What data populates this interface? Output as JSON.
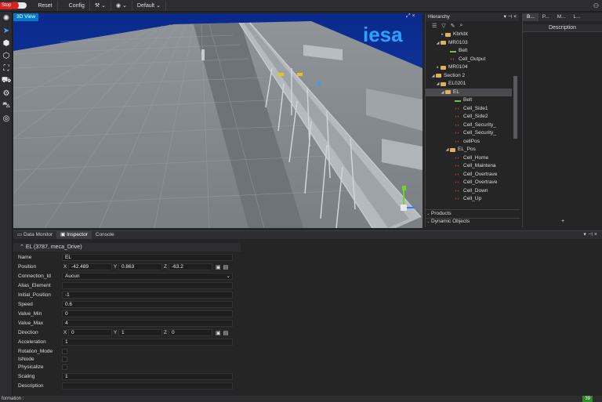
{
  "toolbar": {
    "stop_label": "Stop",
    "reset_label": "Reset",
    "config_label": "Config",
    "view_preset": "Default"
  },
  "viewport": {
    "tab_label": "3D View",
    "logo_text": "iesa"
  },
  "hierarchy": {
    "title": "Hierarchy",
    "rows": [
      {
        "label": "Kbrkbt",
        "type": "folder",
        "indent": 3,
        "arrow": "▸"
      },
      {
        "label": "MR0103",
        "type": "folder",
        "indent": 2,
        "arrow": "◢"
      },
      {
        "label": "Belt",
        "type": "belt",
        "indent": 4,
        "arrow": ""
      },
      {
        "label": "Cell_Output",
        "type": "cell",
        "indent": 4,
        "arrow": ""
      },
      {
        "label": "MR0104",
        "type": "folder",
        "indent": 2,
        "arrow": "▸"
      },
      {
        "label": "Section 2",
        "type": "folder",
        "indent": 1,
        "arrow": "◢"
      },
      {
        "label": "EL0201",
        "type": "folder",
        "indent": 2,
        "arrow": "◢"
      },
      {
        "label": "EL",
        "type": "folder",
        "indent": 3,
        "arrow": "◢",
        "selected": true
      },
      {
        "label": "Belt",
        "type": "belt",
        "indent": 5,
        "arrow": ""
      },
      {
        "label": "Cell_Side1",
        "type": "cell",
        "indent": 5,
        "arrow": ""
      },
      {
        "label": "Cell_Side2",
        "type": "cell",
        "indent": 5,
        "arrow": ""
      },
      {
        "label": "Cell_Security_",
        "type": "cell",
        "indent": 5,
        "arrow": ""
      },
      {
        "label": "Cell_Security_",
        "type": "cell",
        "indent": 5,
        "arrow": ""
      },
      {
        "label": "cellPos",
        "type": "cell",
        "indent": 5,
        "arrow": ""
      },
      {
        "label": "EL_Pos",
        "type": "folder",
        "indent": 4,
        "arrow": "◢"
      },
      {
        "label": "Cell_Home",
        "type": "cell",
        "indent": 5,
        "arrow": ""
      },
      {
        "label": "Cell_Maintena",
        "type": "cell",
        "indent": 5,
        "arrow": ""
      },
      {
        "label": "Cell_Overtrave",
        "type": "cell",
        "indent": 5,
        "arrow": ""
      },
      {
        "label": "Cell_Overtrave",
        "type": "cell",
        "indent": 5,
        "arrow": ""
      },
      {
        "label": "Cell_Down",
        "type": "cell",
        "indent": 5,
        "arrow": ""
      },
      {
        "label": "Cell_Up",
        "type": "cell",
        "indent": 5,
        "arrow": ""
      }
    ],
    "sections": [
      "Products",
      "Dynamic Objects"
    ]
  },
  "right_panel": {
    "tabs": [
      "B...",
      "P...",
      "M...",
      "L..."
    ],
    "description_header": "Description",
    "add_label": "+"
  },
  "inspector": {
    "tabs": [
      "Data Monitor",
      "Inspector",
      "Console"
    ],
    "active_tab": "Inspector",
    "object_header": "EL (3787, meca_Drive)",
    "name": "EL",
    "position": {
      "x": "-42.489",
      "y": "0.863",
      "z": "-63.2"
    },
    "connection_id": "Aucun",
    "alias_element": "",
    "initial_position": "-1",
    "speed": "0.6",
    "value_min": "0",
    "value_max": "4",
    "direction": {
      "x": "0",
      "y": "1",
      "z": "0"
    },
    "acceleration": "1",
    "scaling": "1",
    "description": "",
    "labels": {
      "name": "Name",
      "position": "Position",
      "connection_id": "Connection_Id",
      "alias_element": "Alias_Element",
      "initial_position": "Initial_Position",
      "speed": "Speed",
      "value_min": "Value_Min",
      "value_max": "Value_Max",
      "direction": "Direction",
      "acceleration": "Acceleration",
      "rotation_mode": "Rotation_Mode",
      "isnode": "IsNode",
      "physicalize": "Physicalize",
      "scaling": "Scaling",
      "description": "Description"
    }
  },
  "status": {
    "text": "formation :",
    "badge": "39"
  },
  "colors": {
    "accent": "#007acc",
    "stop": "#d92020",
    "folder": "#dcb35c",
    "belt": "#6cc24a",
    "cell": "#e23b3b"
  }
}
